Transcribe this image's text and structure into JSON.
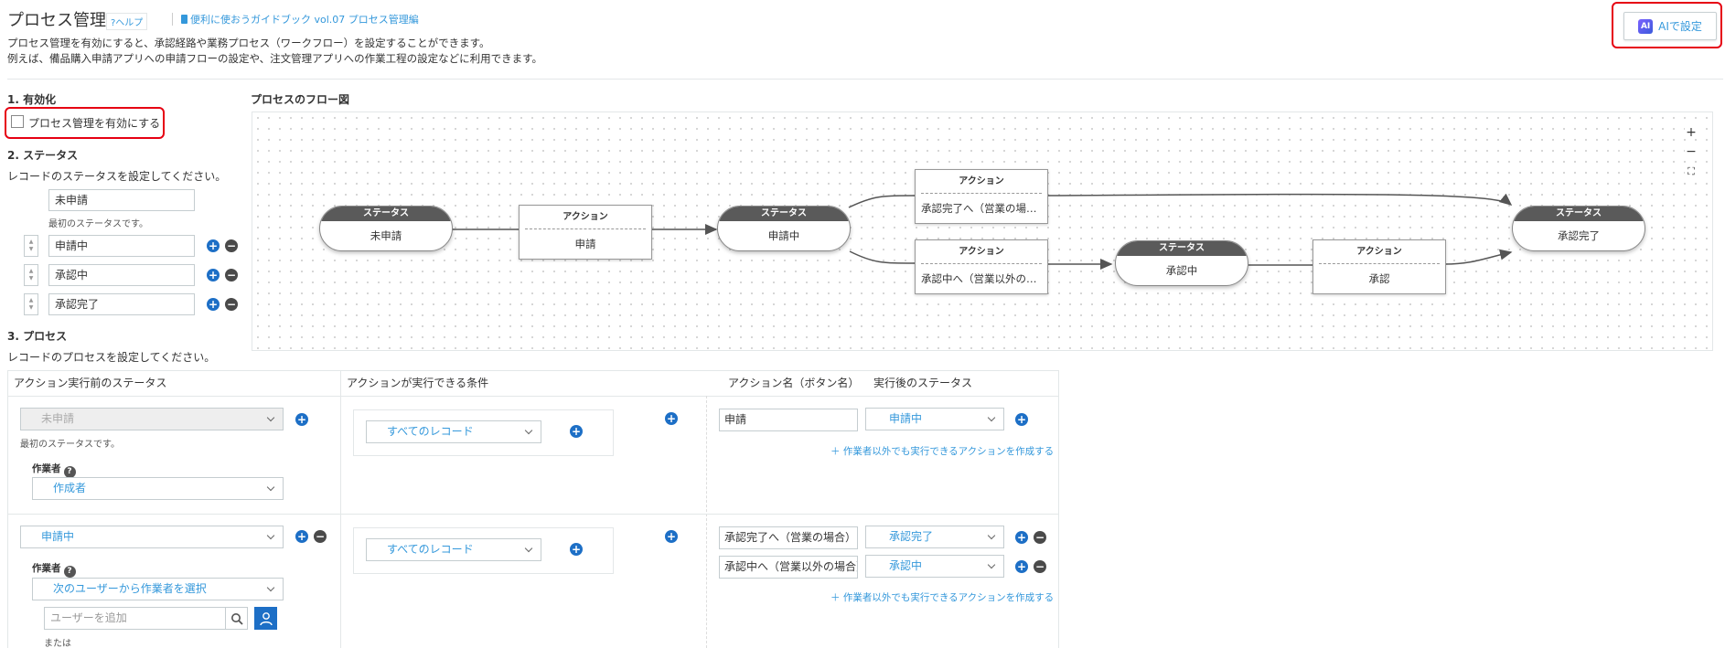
{
  "header": {
    "title": "プロセス管理",
    "help": "?ヘルプ",
    "guide_link": "便利に使おうガイドブック vol.07 プロセス管理編",
    "desc_line1": "プロセス管理を有効にすると、承認経路や業務プロセス（ワークフロー）を設定することができます。",
    "desc_line2": "例えば、備品購入申請アプリへの申請フローの設定や、注文管理アプリへの作業工程の設定などに利用できます。",
    "ai_button": "AIで設定",
    "ai_icon_text": "AI"
  },
  "enable": {
    "heading": "1. 有効化",
    "checkbox_label": "プロセス管理を有効にする",
    "checked": false
  },
  "status": {
    "heading": "2. ステータス",
    "desc": "レコードのステータスを設定してください。",
    "first_value": "未申請",
    "first_note": "最初のステータスです。",
    "items": [
      "申請中",
      "承認中",
      "承認完了"
    ]
  },
  "flow": {
    "heading": "プロセスのフロー図",
    "status_header": "ステータス",
    "action_header": "アクション",
    "statuses": [
      "未申請",
      "申請中",
      "承認中",
      "承認完了"
    ],
    "actions": [
      "申請",
      "承認完了へ（営業の場合）",
      "承認中へ（営業以外の場合）",
      "承認"
    ],
    "zoom_in": "+",
    "zoom_out": "−",
    "fit": "⛶"
  },
  "process": {
    "heading": "3. プロセス",
    "desc": "レコードのプロセスを設定してください。",
    "columns": {
      "before_status": "アクション実行前のステータス",
      "condition": "アクションが実行できる条件",
      "action_name": "アクション名（ボタン名）",
      "after_status": "実行後のステータス"
    },
    "rows": [
      {
        "before_status": "未申請",
        "note": "最初のステータスです。",
        "worker_label": "作業者",
        "worker": "作成者",
        "condition": "すべてのレコード",
        "actions": [
          {
            "name": "申請",
            "after": "申請中"
          }
        ],
        "create_link": "作業者以外でも実行できるアクションを作成する"
      },
      {
        "before_status": "申請中",
        "worker_label": "作業者",
        "worker": "次のユーザーから作業者を選択",
        "user_placeholder": "ユーザーを追加",
        "or": "または",
        "condition": "すべてのレコード",
        "actions": [
          {
            "name": "承認完了へ（営業の場合）",
            "after": "承認完了"
          },
          {
            "name": "承認中へ（営業以外の場合）",
            "after": "承認中"
          }
        ],
        "create_link": "作業者以外でも実行できるアクションを作成する"
      }
    ]
  },
  "colors": {
    "accent": "#3498db",
    "primary_button": "#1d6fc6",
    "highlight": "#e60012",
    "status_header": "#5a5a5a"
  }
}
